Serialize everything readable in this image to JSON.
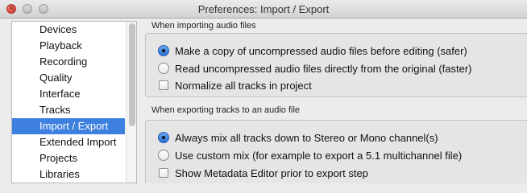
{
  "window": {
    "title": "Preferences: Import / Export"
  },
  "traffic_lights": {
    "close_glyph": "×"
  },
  "sidebar": {
    "items": [
      {
        "label": "Devices",
        "selected": false
      },
      {
        "label": "Playback",
        "selected": false
      },
      {
        "label": "Recording",
        "selected": false
      },
      {
        "label": "Quality",
        "selected": false
      },
      {
        "label": "Interface",
        "selected": false
      },
      {
        "label": "Tracks",
        "selected": false
      },
      {
        "label": "Import / Export",
        "selected": true
      },
      {
        "label": "Extended Import",
        "selected": false
      },
      {
        "label": "Projects",
        "selected": false
      },
      {
        "label": "Libraries",
        "selected": false
      }
    ]
  },
  "import_section": {
    "heading": "When importing audio files",
    "options": [
      {
        "type": "radio",
        "label": "Make a copy of uncompressed audio files before editing (safer)",
        "checked": true
      },
      {
        "type": "radio",
        "label": "Read uncompressed audio files directly from the original (faster)",
        "checked": false
      },
      {
        "type": "checkbox",
        "label": "Normalize all tracks in project",
        "checked": false
      }
    ]
  },
  "export_section": {
    "heading": "When exporting tracks to an audio file",
    "options": [
      {
        "type": "radio",
        "label": "Always mix all tracks down to Stereo or Mono channel(s)",
        "checked": true
      },
      {
        "type": "radio",
        "label": "Use custom mix (for example to export a 5.1 multichannel file)",
        "checked": false
      },
      {
        "type": "checkbox",
        "label": "Show Metadata Editor prior to export step",
        "checked": false
      }
    ]
  },
  "colors": {
    "selection": "#3d80df",
    "radio_checked": "#2a6fd6"
  }
}
